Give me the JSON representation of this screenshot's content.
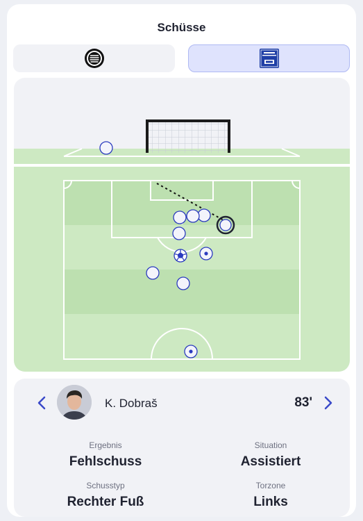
{
  "header": {
    "title": "Schüsse"
  },
  "teams": [
    {
      "name": "SK Sturm Graz",
      "logo": "sturm-graz-logo",
      "selected": false
    },
    {
      "name": "FC Blau Weiss Linz",
      "logo": "blau-weiss-linz-logo",
      "selected": true
    }
  ],
  "shot_map": {
    "pitch_colors": {
      "grass_light": "#cde9c2",
      "grass_dark": "#bde0b0",
      "line": "#ffffff",
      "shot_fill": "#f3f4fb",
      "shot_stroke": "#2b3bbf"
    },
    "shots": [
      {
        "type": "miss-above-goal",
        "selected": false
      },
      {
        "type": "shot",
        "selected": true
      },
      {
        "type": "shot",
        "selected": false
      },
      {
        "type": "shot",
        "selected": false
      },
      {
        "type": "shot",
        "selected": false
      },
      {
        "type": "shot",
        "selected": false
      },
      {
        "type": "goal",
        "selected": false
      },
      {
        "type": "shot-on-target",
        "selected": false
      },
      {
        "type": "shot",
        "selected": false
      },
      {
        "type": "shot",
        "selected": false
      },
      {
        "type": "shot-on-target",
        "selected": false
      }
    ]
  },
  "detail": {
    "player_name": "K. Dobraš",
    "minute": "83'",
    "result_label": "Ergebnis",
    "result_value": "Fehlschuss",
    "situation_label": "Situation",
    "situation_value": "Assistiert",
    "shot_type_label": "Schusstyp",
    "shot_type_value": "Rechter Fuß",
    "goal_zone_label": "Torzone",
    "goal_zone_value": "Links",
    "accent_color": "#3a49c9"
  }
}
